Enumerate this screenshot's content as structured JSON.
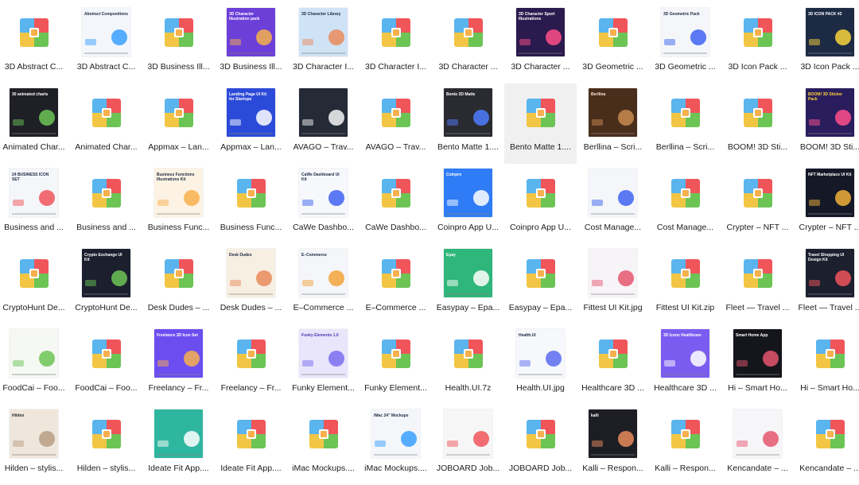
{
  "zip_colors": {
    "top_left": "#5ab4ee",
    "top_right": "#f0555a",
    "bottom_left": "#f2c644",
    "bottom_right": "#6cc455",
    "clasp": "#f7b04d"
  },
  "files": [
    {
      "label": "3D Abstract C...",
      "type": "zip"
    },
    {
      "label": "3D Abstract C...",
      "type": "image",
      "caption": "Abstract Compositions",
      "bg": "#f3f6fb",
      "fg": "#1f2a44",
      "accent": "#3aa0ff"
    },
    {
      "label": "3D Business Ill...",
      "type": "zip"
    },
    {
      "label": "3D Business Ill...",
      "type": "image",
      "caption": "3D Character Illustration pack",
      "bg": "#6b3fd8",
      "fg": "#ffffff",
      "accent": "#f7b24b"
    },
    {
      "label": "3D Character I...",
      "type": "image",
      "caption": "3D Character Library",
      "bg": "#cfe3f6",
      "fg": "#1f2a44",
      "accent": "#e98b5b"
    },
    {
      "label": "3D Character I...",
      "type": "zip"
    },
    {
      "label": "3D Character ...",
      "type": "zip"
    },
    {
      "label": "3D Character ...",
      "type": "image",
      "caption": "3D Character Sport Illustrations",
      "bg": "#2b1a4d",
      "fg": "#ffffff",
      "accent": "#ff4f8b"
    },
    {
      "label": "3D Geometric ...",
      "type": "zip"
    },
    {
      "label": "3D Geometric ...",
      "type": "image",
      "caption": "3D Geometric Pack",
      "bg": "#f4f6fa",
      "fg": "#1f2a44",
      "accent": "#3e63f0"
    },
    {
      "label": "3D Icon Pack ...",
      "type": "zip"
    },
    {
      "label": "3D Icon Pack ...",
      "type": "image",
      "caption": "3D ICON PACK #2",
      "bg": "#1d2a44",
      "fg": "#ffffff",
      "accent": "#f9d33a"
    },
    {
      "label": "Animated Char...",
      "type": "image",
      "caption": "30 animated charts",
      "bg": "#1f1f26",
      "fg": "#ffffff",
      "accent": "#6cc455"
    },
    {
      "label": "Animated Char...",
      "type": "zip"
    },
    {
      "label": "Appmax – Lan...",
      "type": "zip"
    },
    {
      "label": "Appmax – Lan...",
      "type": "image",
      "caption": "Landing Page UI Kit for Startups",
      "bg": "#2c4ad9",
      "fg": "#ffffff",
      "accent": "#ffffff"
    },
    {
      "label": "AVAGO – Trav...",
      "type": "image",
      "caption": "",
      "bg": "#242a36",
      "fg": "#ffffff",
      "accent": "#f4f4f4"
    },
    {
      "label": "AVAGO – Trav...",
      "type": "zip"
    },
    {
      "label": "Bento Matte 1....",
      "type": "image",
      "caption": "Bento 3D Matte",
      "bg": "#2a2b30",
      "fg": "#ffffff",
      "accent": "#4f7cff"
    },
    {
      "label": "Bento Matte 1....",
      "type": "zip",
      "selected": true
    },
    {
      "label": "Berllina – Scri...",
      "type": "image",
      "caption": "Berllina",
      "bg": "#4a2e1c",
      "fg": "#f5e6cf",
      "accent": "#c88a4f"
    },
    {
      "label": "Berllina – Scri...",
      "type": "zip"
    },
    {
      "label": "BOOM! 3D Sti...",
      "type": "zip"
    },
    {
      "label": "BOOM! 3D Sti...",
      "type": "image",
      "caption": "BOOM! 3D Sticker Pack",
      "bg": "#2a1d5e",
      "fg": "#ffd338",
      "accent": "#ff4f8b"
    },
    {
      "label": "Business and ...",
      "type": "image",
      "caption": "24 BUSINESS ICON SET",
      "bg": "#f4f6fa",
      "fg": "#1f2a44",
      "accent": "#f0555a"
    },
    {
      "label": "Business and ...",
      "type": "zip"
    },
    {
      "label": "Business Func...",
      "type": "image",
      "caption": "Business Functions Illustrations Kit",
      "bg": "#fdf3e4",
      "fg": "#1f2a44",
      "accent": "#f7b04d"
    },
    {
      "label": "Business Func...",
      "type": "zip"
    },
    {
      "label": "CaWe Dashbo...",
      "type": "image",
      "caption": "CaWe Dashboard UI Kit",
      "bg": "#f6f8fb",
      "fg": "#1f2a44",
      "accent": "#3e63f0"
    },
    {
      "label": "CaWe Dashbo...",
      "type": "zip"
    },
    {
      "label": "Coinpro App U...",
      "type": "image",
      "caption": "Coinpro",
      "bg": "#2f7cf6",
      "fg": "#ffffff",
      "accent": "#ffffff"
    },
    {
      "label": "Coinpro App U...",
      "type": "zip"
    },
    {
      "label": "Cost Manage...",
      "type": "image",
      "caption": "",
      "bg": "#f4f6fa",
      "fg": "#1f2a44",
      "accent": "#3e63f0"
    },
    {
      "label": "Cost Manage...",
      "type": "zip"
    },
    {
      "label": "Crypter – NFT ...",
      "type": "zip"
    },
    {
      "label": "Crypter – NFT ...",
      "type": "image",
      "caption": "NFT Marketplace UI Kit",
      "bg": "#151827",
      "fg": "#ffffff",
      "accent": "#f0b13a"
    },
    {
      "label": "CryptoHunt De...",
      "type": "zip"
    },
    {
      "label": "CryptoHunt De...",
      "type": "image",
      "caption": "Crypto Exchange UI Kit",
      "bg": "#1b1f2e",
      "fg": "#ffffff",
      "accent": "#6cc455"
    },
    {
      "label": "Desk Dudes – ...",
      "type": "zip"
    },
    {
      "label": "Desk Dudes – ...",
      "type": "image",
      "caption": "Desk Dudes",
      "bg": "#f6efe2",
      "fg": "#1f2a44",
      "accent": "#e98b5b"
    },
    {
      "label": "E–Commerce ...",
      "type": "image",
      "caption": "E–Commerce",
      "bg": "#f4f6fa",
      "fg": "#1f2a44",
      "accent": "#f2a33a"
    },
    {
      "label": "E–Commerce ...",
      "type": "zip"
    },
    {
      "label": "Easypay – Epa...",
      "type": "image",
      "caption": "Epay",
      "bg": "#2fb67a",
      "fg": "#ffffff",
      "accent": "#ffffff"
    },
    {
      "label": "Easypay – Epa...",
      "type": "zip"
    },
    {
      "label": "Fittest UI Kit.jpg",
      "type": "image",
      "caption": "",
      "bg": "#f7f4f8",
      "fg": "#1f2a44",
      "accent": "#e5566e"
    },
    {
      "label": "Fittest UI Kit.zip",
      "type": "zip"
    },
    {
      "label": "Fleet — Travel ...",
      "type": "zip"
    },
    {
      "label": "Fleet — Travel ...",
      "type": "image",
      "caption": "Travel Shopping UI Design Kit",
      "bg": "#1b1f2e",
      "fg": "#ffffff",
      "accent": "#f0555a"
    },
    {
      "label": "FoodCai – Foo...",
      "type": "image",
      "caption": "",
      "bg": "#f6f8f3",
      "fg": "#1f2a44",
      "accent": "#6cc455"
    },
    {
      "label": "FoodCai – Foo...",
      "type": "zip"
    },
    {
      "label": "Freelancy – Fr...",
      "type": "image",
      "caption": "Freelance 3D Icon Set",
      "bg": "#6b4df0",
      "fg": "#ffffff",
      "accent": "#f7b04d"
    },
    {
      "label": "Freelancy – Fr...",
      "type": "zip"
    },
    {
      "label": "Funky Element...",
      "type": "image",
      "caption": "Funky Elements 1.0",
      "bg": "#e9e6fb",
      "fg": "#4a3bb0",
      "accent": "#7b6cf0"
    },
    {
      "label": "Funky Element...",
      "type": "zip"
    },
    {
      "label": "Health.UI.7z",
      "type": "zip"
    },
    {
      "label": "Health.UI.jpg",
      "type": "image",
      "caption": "Health.UI",
      "bg": "#f6f8fb",
      "fg": "#1f2a44",
      "accent": "#5a6cf0"
    },
    {
      "label": "Healthcare 3D ...",
      "type": "zip"
    },
    {
      "label": "Healthcare 3D ...",
      "type": "image",
      "caption": "3D Icons Healthcare",
      "bg": "#7b5cf0",
      "fg": "#ffffff",
      "accent": "#ffffff"
    },
    {
      "label": "Hi – Smart Ho...",
      "type": "image",
      "caption": "Smart Home App",
      "bg": "#15161c",
      "fg": "#ffffff",
      "accent": "#e5566e"
    },
    {
      "label": "Hi – Smart Ho...",
      "type": "zip"
    },
    {
      "label": "Hilden – stylis...",
      "type": "image",
      "caption": "Hilden",
      "bg": "#efe6dc",
      "fg": "#2a2a2a",
      "accent": "#b79c84"
    },
    {
      "label": "Hilden – stylis...",
      "type": "zip"
    },
    {
      "label": "Ideate Fit App....",
      "type": "image",
      "caption": "",
      "bg": "#2fb6a0",
      "fg": "#ffffff",
      "accent": "#ffffff"
    },
    {
      "label": "Ideate Fit App....",
      "type": "zip"
    },
    {
      "label": "iMac Mockups....",
      "type": "zip"
    },
    {
      "label": "iMac Mockups....",
      "type": "image",
      "caption": "iMac 24\" Mockups",
      "bg": "#f4f6fa",
      "fg": "#1f2a44",
      "accent": "#3aa0ff"
    },
    {
      "label": "JOBOARD Job...",
      "type": "image",
      "caption": "",
      "bg": "#f6f6f6",
      "fg": "#1f2a44",
      "accent": "#f0555a"
    },
    {
      "label": "JOBOARD Job...",
      "type": "zip"
    },
    {
      "label": "Kalli – Respon...",
      "type": "image",
      "caption": "kalli",
      "bg": "#1d1e24",
      "fg": "#ffffff",
      "accent": "#e98b5b"
    },
    {
      "label": "Kalli – Respon...",
      "type": "zip"
    },
    {
      "label": "Kencandate – ...",
      "type": "image",
      "caption": "",
      "bg": "#f6f6f8",
      "fg": "#1f2a44",
      "accent": "#e5566e"
    },
    {
      "label": "Kencandate – ...",
      "type": "zip"
    }
  ]
}
